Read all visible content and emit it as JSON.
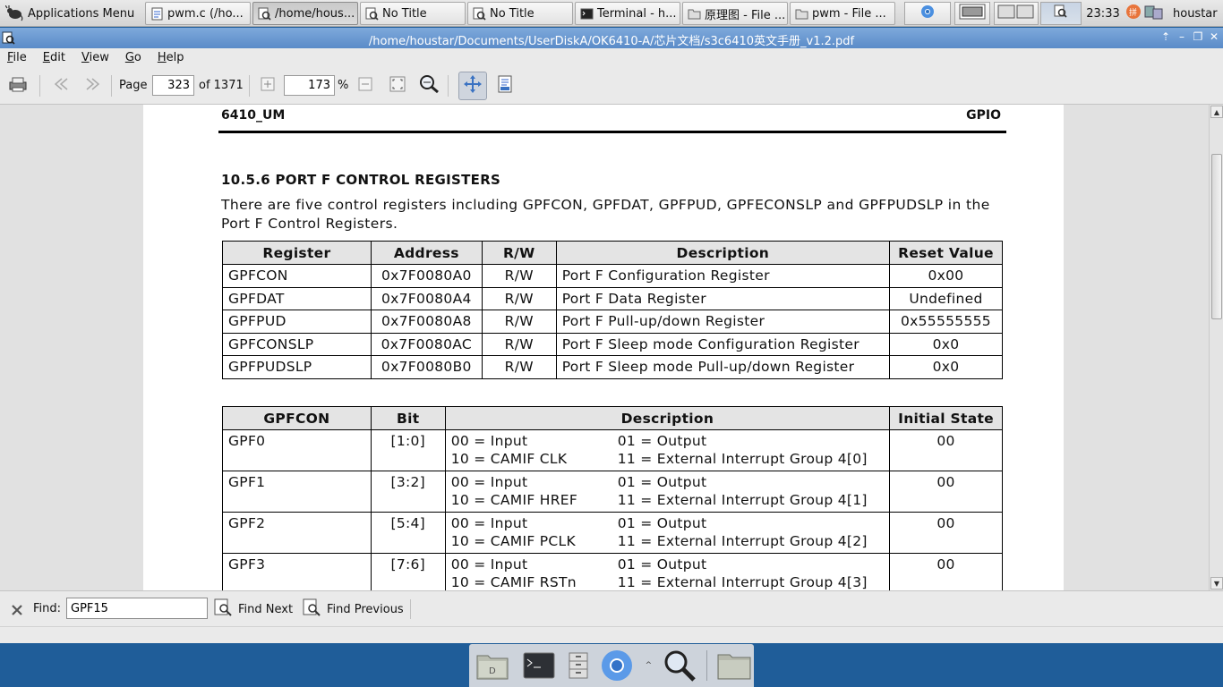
{
  "panel": {
    "apps_menu_label": "Applications Menu",
    "tasks": [
      {
        "label": "pwm.c (/ho...",
        "icon": "gedit-icon"
      },
      {
        "label": "/home/hous...",
        "icon": "evince-icon"
      },
      {
        "label": "No Title",
        "icon": "evince-icon"
      },
      {
        "label": "No Title",
        "icon": "evince-icon"
      },
      {
        "label": "Terminal - h...",
        "icon": "terminal-icon"
      },
      {
        "label": "原理图 - File ...",
        "icon": "folder-icon"
      },
      {
        "label": "pwm - File ...",
        "icon": "folder-icon"
      }
    ],
    "clock": "23:33",
    "user": "houstar"
  },
  "window": {
    "title": "/home/houstar/Documents/UserDiskA/OK6410-A/芯片文档/s3c6410英文手册_v1.2.pdf"
  },
  "menu": [
    "File",
    "Edit",
    "View",
    "Go",
    "Help"
  ],
  "toolbar": {
    "page_label": "Page",
    "page_value": "323",
    "page_total": "of 1371",
    "zoom_value": "173",
    "zoom_unit": "%"
  },
  "document": {
    "header_left": "6410_UM",
    "header_right": "GPIO",
    "section_title": "10.5.6 PORT F CONTROL REGISTERS",
    "intro": "There are five control registers including GPFCON, GPFDAT, GPFPUD, GPFECONSLP and GPFPUDSLP in the Port F Control Registers.",
    "table1": {
      "headers": [
        "Register",
        "Address",
        "R/W",
        "Description",
        "Reset Value"
      ],
      "rows": [
        [
          "GPFCON",
          "0x7F0080A0",
          "R/W",
          "Port F Configuration Register",
          "0x00"
        ],
        [
          "GPFDAT",
          "0x7F0080A4",
          "R/W",
          "Port F Data Register",
          "Undefined"
        ],
        [
          "GPFPUD",
          "0x7F0080A8",
          "R/W",
          "Port F Pull-up/down Register",
          "0x55555555"
        ],
        [
          "GPFCONSLP",
          "0x7F0080AC",
          "R/W",
          "Port F Sleep mode Configuration Register",
          "0x0"
        ],
        [
          "GPFPUDSLP",
          "0x7F0080B0",
          "R/W",
          "Port F Sleep mode Pull-up/down Register",
          "0x0"
        ]
      ]
    },
    "table2": {
      "headers": [
        "GPFCON",
        "Bit",
        "Description",
        "Initial State"
      ],
      "rows": [
        {
          "name": "GPF0",
          "bit": "[1:0]",
          "d1": "00 = Input",
          "d2": "01 = Output",
          "d3": "10 = CAMIF CLK",
          "d4": "11 = External Interrupt Group 4[0]",
          "init": "00"
        },
        {
          "name": "GPF1",
          "bit": "[3:2]",
          "d1": "00 = Input",
          "d2": "01 = Output",
          "d3": "10 = CAMIF HREF",
          "d4": "11 = External Interrupt Group 4[1]",
          "init": "00"
        },
        {
          "name": "GPF2",
          "bit": "[5:4]",
          "d1": "00 = Input",
          "d2": "01 = Output",
          "d3": "10 = CAMIF PCLK",
          "d4": "11 = External Interrupt Group 4[2]",
          "init": "00"
        },
        {
          "name": "GPF3",
          "bit": "[7:6]",
          "d1": "00 = Input",
          "d2": "01 = Output",
          "d3": "10 = CAMIF RSTn",
          "d4": "11 = External Interrupt Group 4[3]",
          "init": "00"
        }
      ]
    }
  },
  "findbar": {
    "label": "Find:",
    "value": "GPF15",
    "next_label": "Find Next",
    "prev_label": "Find Previous"
  },
  "dock": [
    "file-manager-icon",
    "terminal-icon",
    "drawer-icon",
    "chromium-icon",
    "search-icon",
    "folder-icon"
  ]
}
